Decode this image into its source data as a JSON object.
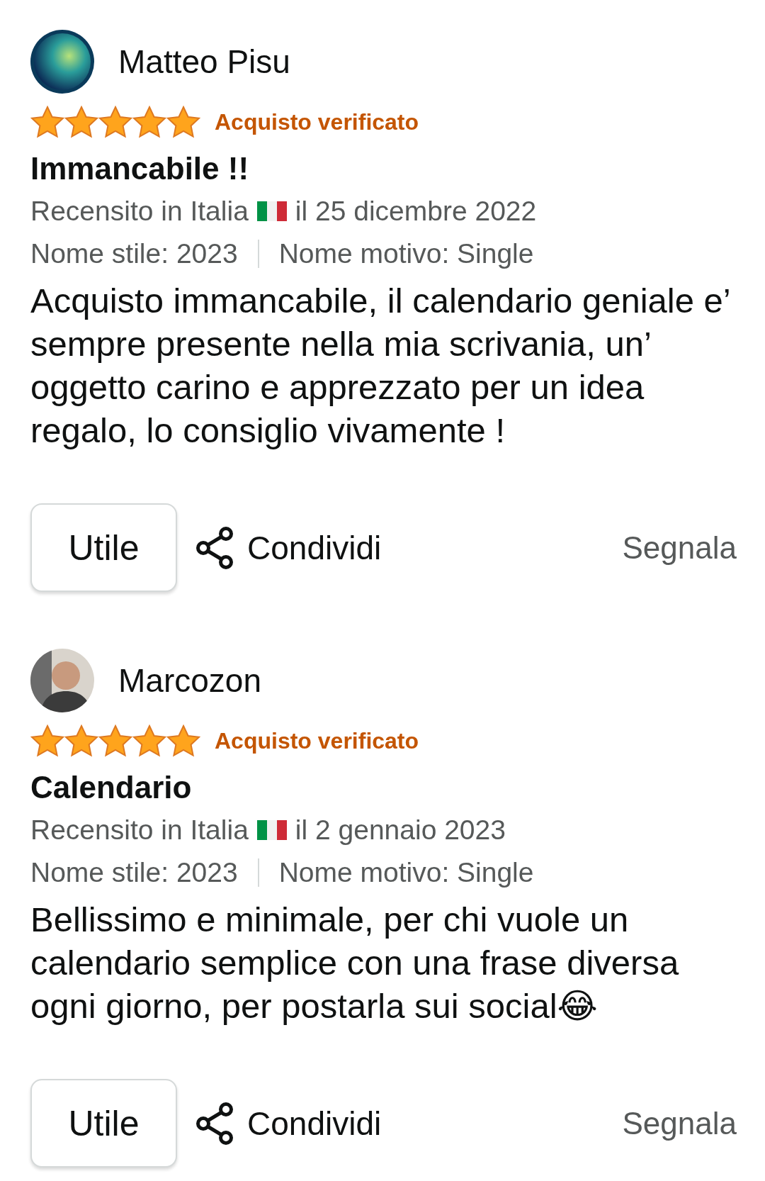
{
  "reviews": [
    {
      "author": "Matteo Pisu",
      "stars": 5,
      "badge": "Acquisto verificato",
      "title": "Immancabile !!",
      "reviewed_prefix": "Recensito in Italia",
      "reviewed_date": "il 25 dicembre 2022",
      "style": "Nome stile: 2023",
      "pattern": "Nome motivo: Single",
      "body": "Acquisto immancabile, il calendario geniale e’ sempre presente nella mia scrivania, un’ oggetto carino e apprezzato per un idea regalo, lo consiglio vivamente !",
      "helpful": "Utile",
      "share": "Condividi",
      "report": "Segnala"
    },
    {
      "author": "Marcozon",
      "stars": 5,
      "badge": "Acquisto verificato",
      "title": "Calendario",
      "reviewed_prefix": "Recensito in Italia",
      "reviewed_date": "il 2 gennaio 2023",
      "style": "Nome stile: 2023",
      "pattern": "Nome motivo: Single",
      "body": "Bellissimo e minimale, per chi vuole un calendario semplice con una frase diversa ogni giorno, per postarla sui social😂",
      "helpful": "Utile",
      "share": "Condividi",
      "report": "Segnala"
    }
  ]
}
